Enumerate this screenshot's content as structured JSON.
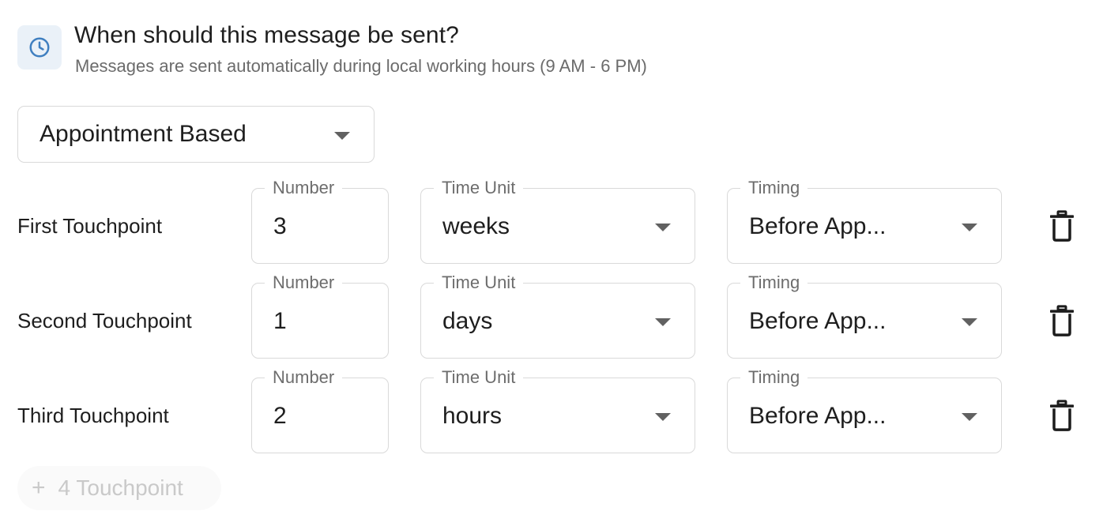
{
  "header": {
    "title": "When should this message be sent?",
    "subtitle": "Messages are sent automatically during local working hours (9 AM - 6 PM)"
  },
  "schedule_mode": {
    "value": "Appointment Based"
  },
  "field_labels": {
    "number": "Number",
    "time_unit": "Time Unit",
    "timing": "Timing"
  },
  "touchpoints": [
    {
      "label": "First Touchpoint",
      "number": "3",
      "time_unit": "weeks",
      "timing": "Before App..."
    },
    {
      "label": "Second Touchpoint",
      "number": "1",
      "time_unit": "days",
      "timing": "Before App..."
    },
    {
      "label": "Third Touchpoint",
      "number": "2",
      "time_unit": "hours",
      "timing": "Before App..."
    }
  ],
  "add_button": {
    "icon": "+",
    "label": "4 Touchpoint",
    "disabled": true
  },
  "colors": {
    "accent": "#3f7fc0",
    "badge_bg": "#eaf1f8",
    "border": "#d9d9d9",
    "disabled_text": "#c9c9c9"
  },
  "icons": {
    "header": "clock-icon",
    "delete": "trash-icon",
    "dropdown": "caret-down-icon"
  }
}
